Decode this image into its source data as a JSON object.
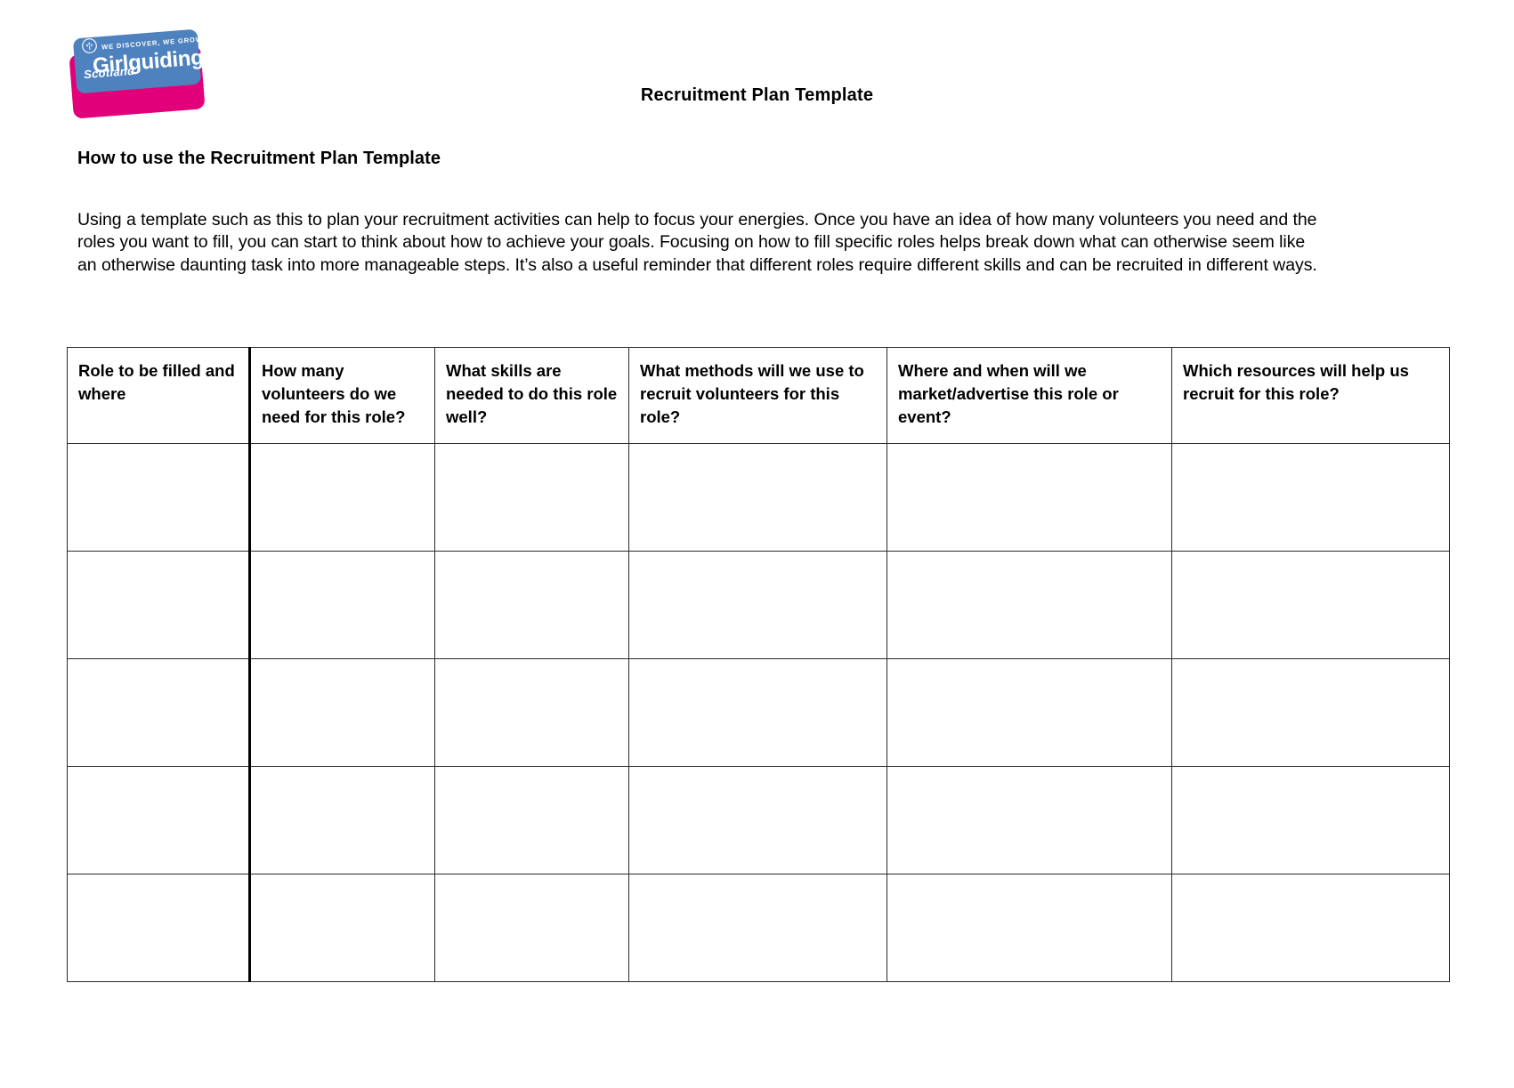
{
  "document": {
    "title": "Recruitment Plan Template",
    "section_heading": "How to use the Recruitment Plan Template",
    "intro_paragraph": "Using a template such as this to plan your recruitment activities can help to focus your energies. Once you have an idea of how many volunteers you need and the roles you want to fill, you can start to think about how to achieve your goals. Focusing on how to fill specific roles helps break down what can otherwise seem like an otherwise daunting task into more manageable steps. It’s also a useful reminder that different roles require different skills and can be recruited in different ways."
  },
  "logo": {
    "tagline": "WE DISCOVER, WE GROW",
    "wordmark": "Girlguiding",
    "region": "Scotland",
    "colors": {
      "blue": "#4e82bf",
      "pink": "#e2007a",
      "text": "#ffffff"
    }
  },
  "table": {
    "headers": [
      "Role to be filled and where",
      "How many volunteers do we need for this role?",
      "What skills are needed to do this role well?",
      "What methods will we use to recruit volunteers for this role?",
      "Where and when will we market/advertise this role or event?",
      "Which resources will help us recruit for this role?"
    ],
    "row_count": 5,
    "rows": [
      [
        "",
        "",
        "",
        "",
        "",
        ""
      ],
      [
        "",
        "",
        "",
        "",
        "",
        ""
      ],
      [
        "",
        "",
        "",
        "",
        "",
        ""
      ],
      [
        "",
        "",
        "",
        "",
        "",
        ""
      ],
      [
        "",
        "",
        "",
        "",
        "",
        ""
      ]
    ]
  }
}
